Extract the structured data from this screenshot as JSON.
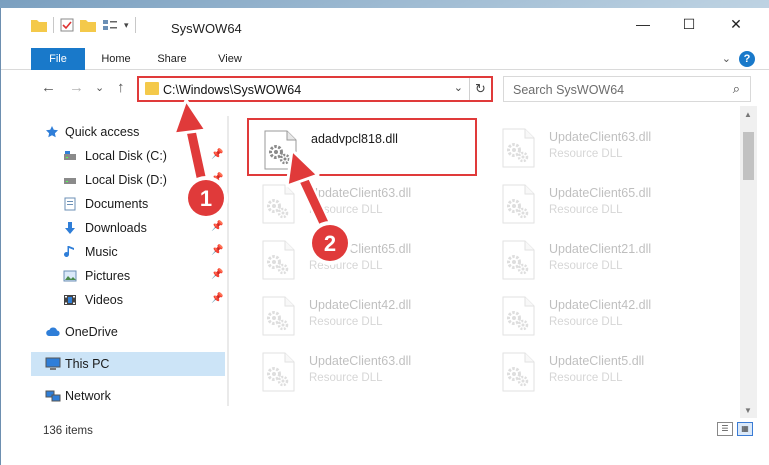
{
  "window": {
    "title": "SysWOW64",
    "controls": {
      "minimize": "—",
      "maximize": "☐",
      "close": "✕"
    }
  },
  "ribbon": {
    "tabs": [
      {
        "label": "File",
        "active": true
      },
      {
        "label": "Home"
      },
      {
        "label": "Share"
      },
      {
        "label": "View"
      }
    ],
    "help": "?"
  },
  "nav": {
    "back": "←",
    "forward": "→",
    "recent": "⌄",
    "up": "↑",
    "address": "C:\\Windows\\SysWOW64",
    "address_dropdown": "⌄",
    "refresh": "↻",
    "search_placeholder": "Search SysWOW64",
    "search_icon": "⌕"
  },
  "sidebar": {
    "items": [
      {
        "label": "Quick access",
        "icon": "star-icon",
        "pinned": false
      },
      {
        "label": "Local Disk (C:)",
        "icon": "drive-icon",
        "pinned": true
      },
      {
        "label": "Local Disk (D:)",
        "icon": "drive-icon",
        "pinned": true
      },
      {
        "label": "Documents",
        "icon": "documents-icon",
        "pinned": true
      },
      {
        "label": "Downloads",
        "icon": "download-icon",
        "pinned": true
      },
      {
        "label": "Music",
        "icon": "music-icon",
        "pinned": true
      },
      {
        "label": "Pictures",
        "icon": "pictures-icon",
        "pinned": true
      },
      {
        "label": "Videos",
        "icon": "videos-icon",
        "pinned": true
      },
      {
        "label": "OneDrive",
        "icon": "cloud-icon",
        "pinned": false
      },
      {
        "label": "This PC",
        "icon": "computer-icon",
        "pinned": false,
        "selected": true
      },
      {
        "label": "Network",
        "icon": "network-icon",
        "pinned": false
      }
    ],
    "pin_glyph": "📌"
  },
  "files": [
    {
      "name": "adadvpcl818.dll",
      "type": "",
      "highlighted": true
    },
    {
      "name": "UpdateClient63.dll",
      "type": "Resource DLL"
    },
    {
      "name": "UpdateClient63.dll",
      "type": "Resource DLL"
    },
    {
      "name": "UpdateClient65.dll",
      "type": "Resource DLL"
    },
    {
      "name": "UpdateClient65.dll",
      "type": "Resource DLL"
    },
    {
      "name": "UpdateClient21.dll",
      "type": "Resource DLL"
    },
    {
      "name": "UpdateClient42.dll",
      "type": "Resource DLL"
    },
    {
      "name": "UpdateClient42.dll",
      "type": "Resource DLL"
    },
    {
      "name": "UpdateClient63.dll",
      "type": "Resource DLL"
    },
    {
      "name": "UpdateClient5.dll",
      "type": "Resource DLL"
    }
  ],
  "status": {
    "item_count": "136 items"
  },
  "annotations": [
    {
      "label": "1",
      "color": "#e03a3a"
    },
    {
      "label": "2",
      "color": "#e03a3a"
    }
  ]
}
